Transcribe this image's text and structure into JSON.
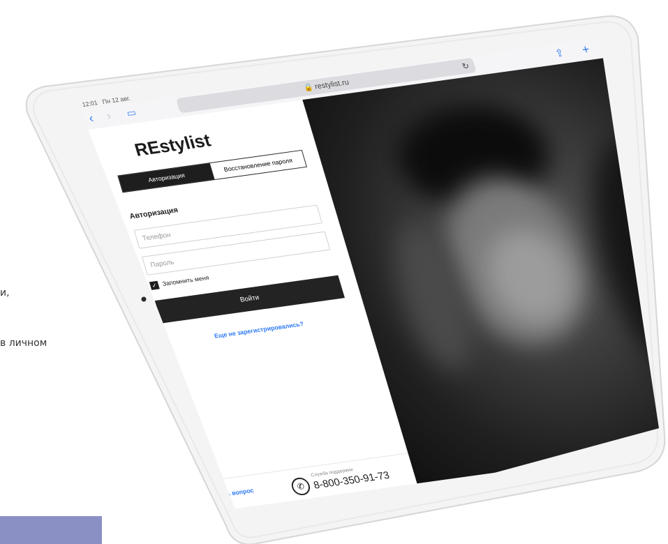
{
  "page": {
    "text_line_1": "и,",
    "text_line_2": "в личном"
  },
  "browser": {
    "time": "12:01",
    "date": "Пн 12 авг.",
    "url": "restylist.ru"
  },
  "login": {
    "brand": "REstylist",
    "tabs": [
      "Авторизация",
      "Восстановление пароля"
    ],
    "form_title": "Авторизация",
    "phone_placeholder": "Телефон",
    "password_placeholder": "Пароль",
    "remember_label": "Запомнить меня",
    "login_button": "Войти",
    "register_link": "Еще не зарегистрировались?",
    "ask_link": "Задать вопрос",
    "support_label": "Служба поддержки",
    "support_phone": "8-800-350-91-73"
  },
  "colors": {
    "promo_block": "#8b90c4",
    "link": "#2f7bf5",
    "button": "#232323"
  }
}
